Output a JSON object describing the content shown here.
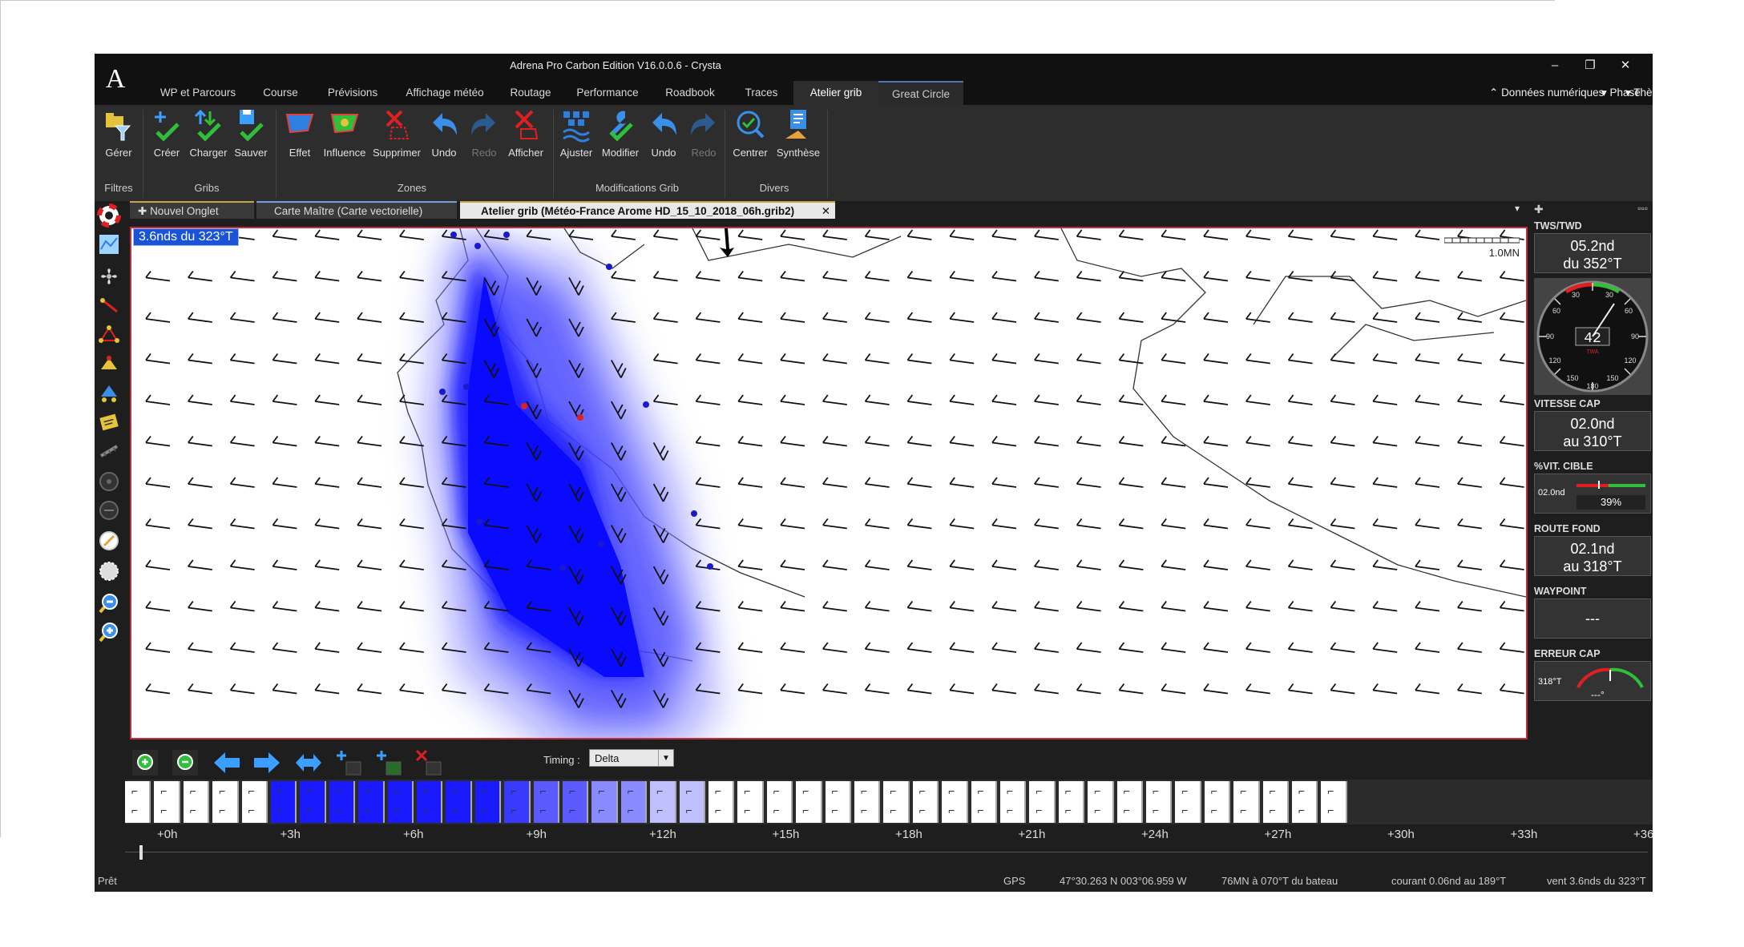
{
  "window": {
    "title": "Adrena Pro Carbon Edition V16.0.0.6 - Crysta",
    "logo": "A",
    "buttons": {
      "minimize": "–",
      "restore": "❐",
      "close": "✕"
    }
  },
  "menu": {
    "tabs": [
      "WP et Parcours",
      "Course",
      "Prévisions",
      "Affichage météo",
      "Routage",
      "Performance",
      "Roadbook",
      "Traces",
      "Atelier grib",
      "Great Circle"
    ],
    "active": "Atelier grib",
    "right": {
      "numeric": "Données numériques",
      "phase": "Phase",
      "theme": "Thème",
      "help": "?"
    }
  },
  "ribbon": {
    "buttons": [
      {
        "label": "Gérer",
        "icon": "folder-filter-icon"
      },
      {
        "label": "Créer",
        "icon": "create-icon"
      },
      {
        "label": "Charger",
        "icon": "load-icon"
      },
      {
        "label": "Sauver",
        "icon": "save-icon"
      },
      {
        "label": "Effet",
        "icon": "effect-icon"
      },
      {
        "label": "Influence",
        "icon": "influence-icon"
      },
      {
        "label": "Supprimer",
        "icon": "delete-icon"
      },
      {
        "label": "Undo",
        "icon": "undo-icon"
      },
      {
        "label": "Redo",
        "icon": "redo-icon"
      },
      {
        "label": "Afficher",
        "icon": "show-icon"
      },
      {
        "label": "Ajuster",
        "icon": "adjust-icon"
      },
      {
        "label": "Modifier",
        "icon": "modify-icon"
      },
      {
        "label": "Undo",
        "icon": "undo-icon"
      },
      {
        "label": "Redo",
        "icon": "redo-icon"
      },
      {
        "label": "Centrer",
        "icon": "center-icon"
      },
      {
        "label": "Synthèse",
        "icon": "synthesis-icon"
      }
    ],
    "groups": [
      "Filtres",
      "Gribs",
      "Zones",
      "Modifications Grib",
      "Divers"
    ]
  },
  "doc_tabs": {
    "new_tab": "Nouvel Onglet",
    "tab1": "Carte Maître (Carte vectorielle)",
    "tab2": "Atelier grib (Météo-France Arome HD_15_10_2018_06h.grib2)",
    "close": "✕"
  },
  "map": {
    "wind_label": "3.6nds du 323°T",
    "scale": "1.0MN"
  },
  "instruments": {
    "tws": {
      "title": "TWS/TWD",
      "line1": "05.2nd",
      "line2": "du 352°T"
    },
    "gauge": {
      "value": "42",
      "unit": "TWA"
    },
    "vitesse": {
      "title": "VITESSE CAP",
      "line1": "02.0nd",
      "line2": "au 310°T"
    },
    "cible": {
      "title": "%VIT. CIBLE",
      "speed": "02.0nd",
      "percent": "39%"
    },
    "route": {
      "title": "ROUTE FOND",
      "line1": "02.1nd",
      "line2": "au 318°T"
    },
    "waypoint": {
      "title": "WAYPOINT",
      "value": "---"
    },
    "erreur": {
      "title": "ERREUR CAP",
      "cap": "318°T",
      "value": "---°"
    }
  },
  "timeline": {
    "timing_label": "Timing :",
    "timing_value": "Delta",
    "hours": [
      "+0h",
      "+3h",
      "+6h",
      "+9h",
      "+12h",
      "+15h",
      "+18h",
      "+21h",
      "+24h",
      "+27h",
      "+30h",
      "+33h",
      "+36"
    ]
  },
  "status": {
    "left": "Prêt",
    "gps": "GPS",
    "position": "47°30.263 N  003°06.959 W",
    "distance": "76MN à 070°T du bateau",
    "current": "courant 0.06nd au 189°T",
    "wind": "vent 3.6nds du 323°T"
  },
  "colors": {
    "accent": "#4a79b8",
    "map_border": "#c0303a",
    "zone": "#1a1aff",
    "label_bg": "#1a54d6"
  }
}
